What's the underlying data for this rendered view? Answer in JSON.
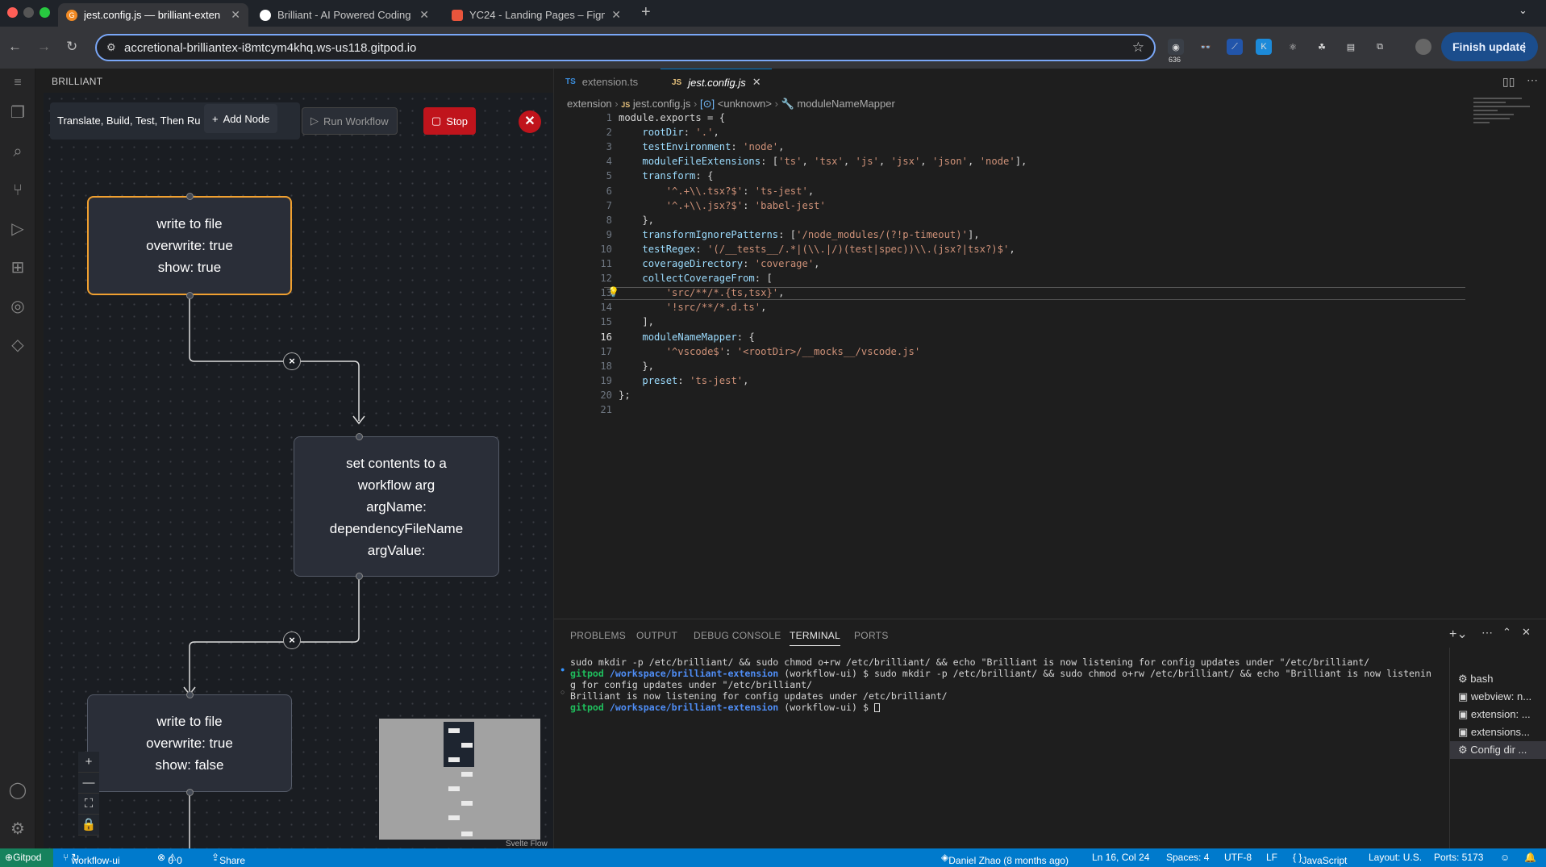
{
  "browser": {
    "tabs": [
      {
        "title": "jest.config.js — brilliant-exten",
        "active": true
      },
      {
        "title": "Brilliant - AI Powered Coding",
        "active": false
      },
      {
        "title": "YC24 - Landing Pages – Figm",
        "active": false
      }
    ],
    "url": "accretional-brilliantex-i8mtcym4khq.ws-us118.gitpod.io",
    "ext_badge": "636",
    "finish_update": "Finish update"
  },
  "sidebar": {
    "title": "BRILLIANT",
    "workflow_name": "Translate, Build, Test, Then Ru",
    "add_node": "Add Node",
    "run_workflow": "Run Workflow",
    "stop": "Stop",
    "nodes": [
      {
        "lines": [
          "write to file",
          "overwrite: true",
          "show: true"
        ]
      },
      {
        "lines": [
          "set contents to a",
          "workflow arg",
          "argName:",
          "dependencyFileName",
          "argValue:"
        ]
      },
      {
        "lines": [
          "write to file",
          "overwrite: true",
          "show: false"
        ]
      }
    ],
    "attribution": "Svelte Flow"
  },
  "editor": {
    "tabs": [
      {
        "icon": "TS",
        "label": "extension.ts",
        "active": false
      },
      {
        "icon": "JS",
        "label": "jest.config.js",
        "active": true
      }
    ],
    "breadcrumbs": [
      "extension",
      "jest.config.js",
      "<unknown>",
      "moduleNameMapper"
    ],
    "lines": [
      "module.exports = {",
      "    rootDir: '.',",
      "    testEnvironment: 'node',",
      "    moduleFileExtensions: ['ts', 'tsx', 'js', 'jsx', 'json', 'node'],",
      "    transform: {",
      "        '^.+\\\\.tsx?$': 'ts-jest',",
      "        '^.+\\\\.jsx?$': 'babel-jest'",
      "    },",
      "    transformIgnorePatterns: ['/node_modules/(?!p-timeout)'],",
      "    testRegex: '(/__tests__/.*|(\\\\.|/)(test|spec))\\\\.(jsx?|tsx?)$',",
      "    coverageDirectory: 'coverage',",
      "    collectCoverageFrom: [",
      "        'src/**/*.{ts,tsx}',",
      "        '!src/**/*.d.ts',",
      "    ],",
      "    moduleNameMapper: {",
      "        '^vscode$': '<rootDir>/__mocks__/vscode.js'",
      "    },",
      "    preset: 'ts-jest',",
      "};",
      ""
    ],
    "current_line": 16
  },
  "panel": {
    "tabs": [
      "PROBLEMS",
      "OUTPUT",
      "DEBUG CONSOLE",
      "TERMINAL",
      "PORTS"
    ],
    "active_tab": "TERMINAL",
    "terminal": {
      "line1": "sudo mkdir -p /etc/brilliant/ && sudo chmod o+rw /etc/brilliant/ && echo \"Brilliant is now listening for config updates under \"/etc/brilliant/",
      "prompt_user": "gitpod",
      "prompt_path": "/workspace/brilliant-extension",
      "prompt_branch": "(workflow-ui) $",
      "line2_cmd": " sudo mkdir -p /etc/brilliant/ && sudo chmod o+rw /etc/brilliant/ && echo \"Brilliant is now listenin",
      "line3": "g for config updates under \"/etc/brilliant/",
      "line4": "Brilliant is now listening for config updates under /etc/brilliant/"
    },
    "terminal_list": [
      "bash",
      "webview: n...",
      "extension: ...",
      "extensions...",
      "Config dir ..."
    ]
  },
  "status": {
    "gitpod": "Gitpod",
    "branch": "workflow-ui",
    "errors": "0",
    "warnings": "0",
    "share": "Share",
    "blame": "Daniel Zhao (8 months ago)",
    "cursor": "Ln 16, Col 24",
    "spaces": "Spaces: 4",
    "encoding": "UTF-8",
    "eol": "LF",
    "language": "JavaScript",
    "layout": "Layout: U.S.",
    "ports": "Ports: 5173"
  },
  "colors": {
    "accent": "#007acc",
    "stop": "#c0141c",
    "selected_node": "#f0a030"
  }
}
